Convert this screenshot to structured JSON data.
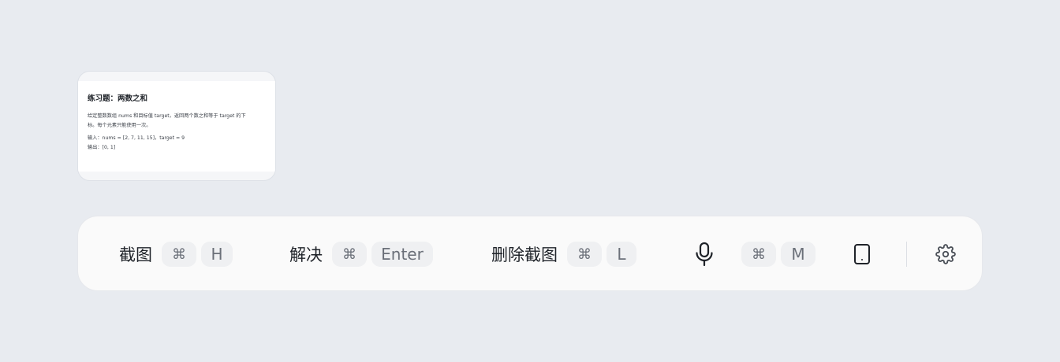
{
  "preview": {
    "title": "练习题：两数之和",
    "line1": "给定整数数组 nums 和目标值 target，返回两个数之和等于 target 的下",
    "line2": "标。每个元素只能使用一次。",
    "line3": "输入：nums = [2, 7, 11, 15]，target = 9",
    "line4": "输出：[0, 1]"
  },
  "toolbar": {
    "screenshot": {
      "label": "截图",
      "keys": [
        "⌘",
        "H"
      ]
    },
    "solve": {
      "label": "解决",
      "keys": [
        "⌘",
        "Enter"
      ]
    },
    "delete": {
      "label": "删除截图",
      "keys": [
        "⌘",
        "L"
      ]
    },
    "voice": {
      "icon": "microphone-icon",
      "keys": [
        "⌘",
        "M"
      ]
    },
    "device": {
      "icon": "tablet-icon"
    },
    "settings": {
      "icon": "gear-icon"
    }
  }
}
